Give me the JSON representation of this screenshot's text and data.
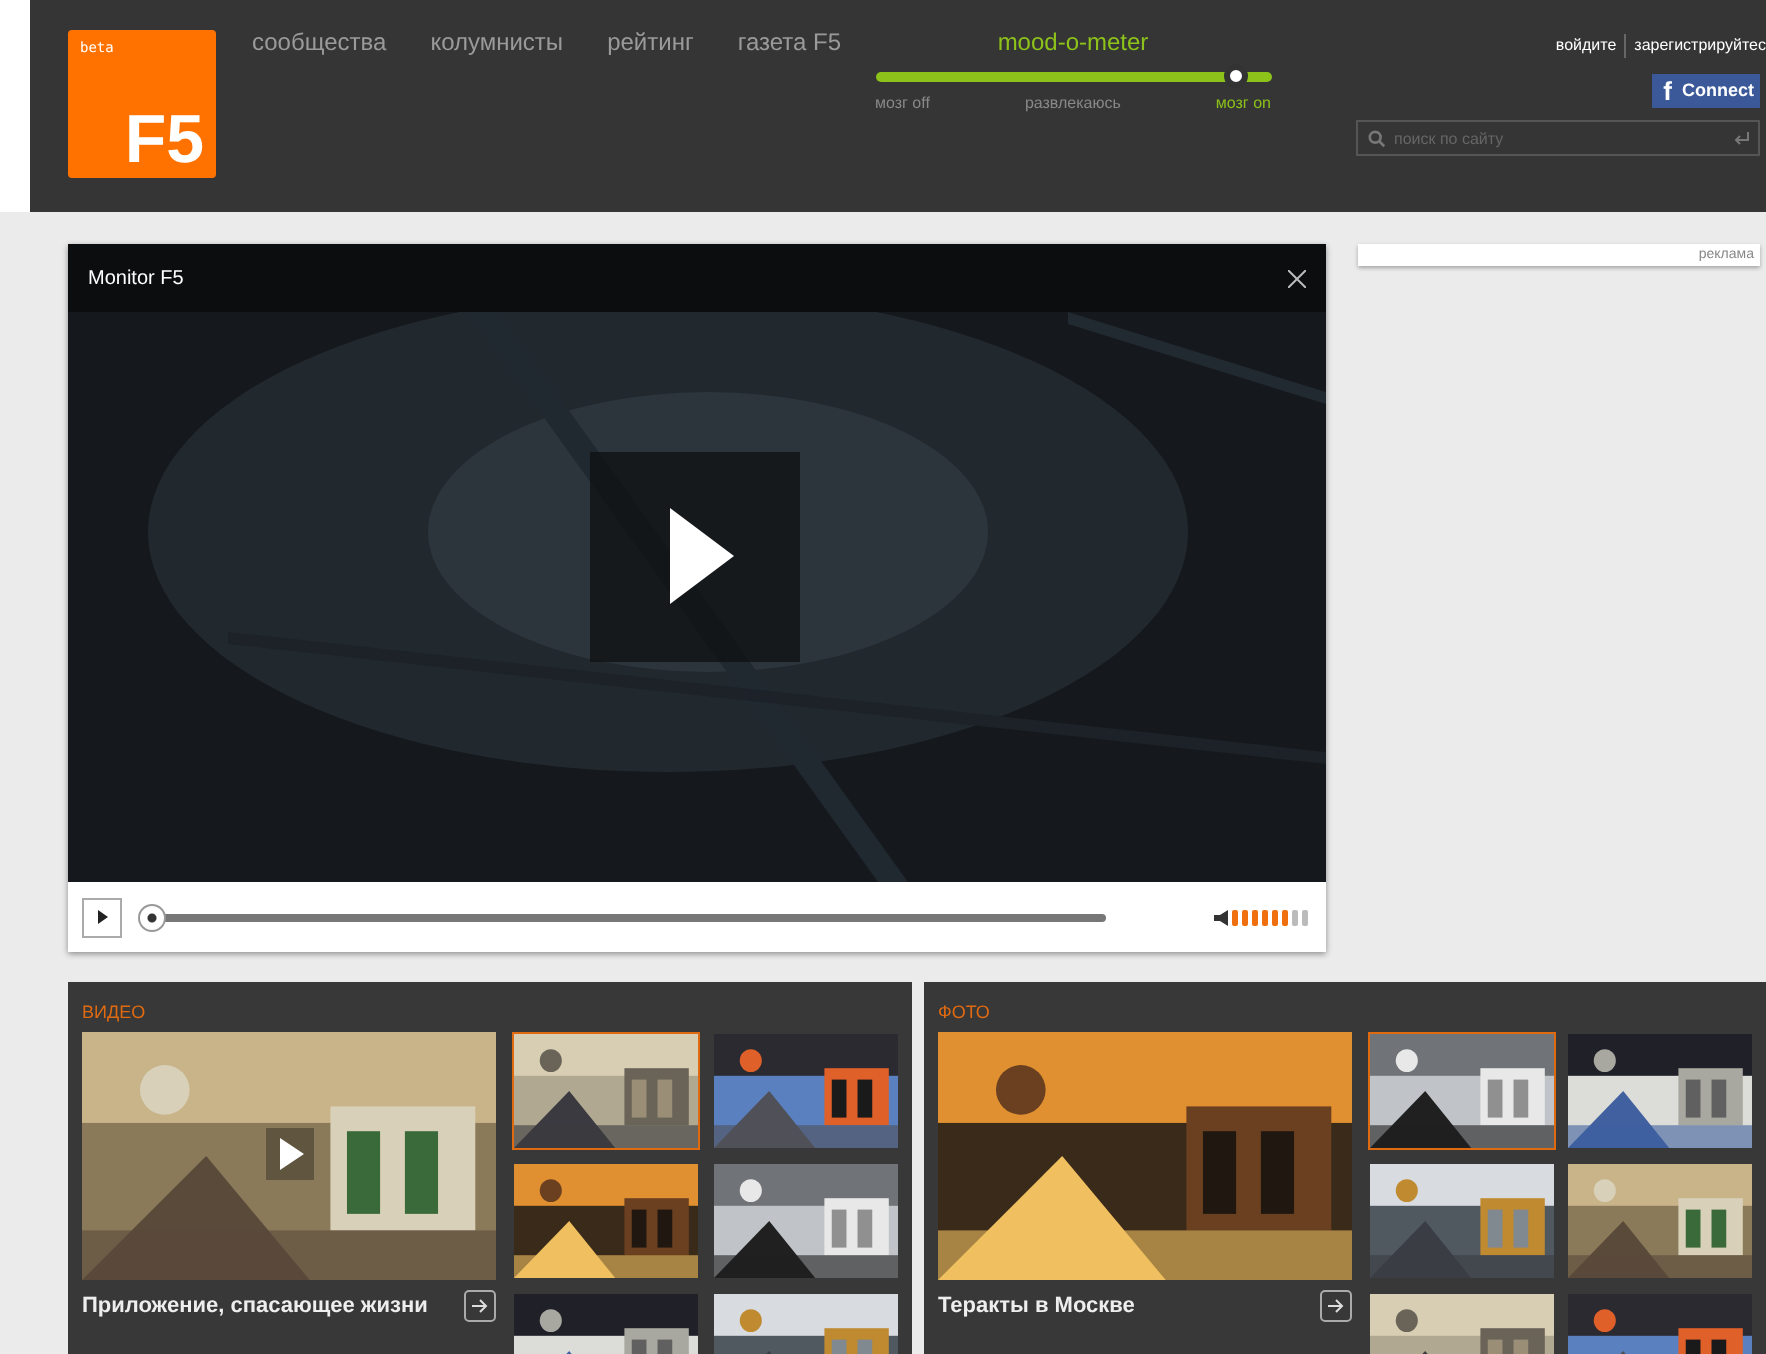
{
  "logo": {
    "badge": "beta",
    "text": "F5"
  },
  "nav": [
    "сообщества",
    "колумнисты",
    "рейтинг",
    "газета F5"
  ],
  "mood_meter": {
    "title": "mood-o-meter",
    "level": 0.91,
    "stops": [
      {
        "label": "мозг off",
        "selected": false
      },
      {
        "label": "развлекаюсь",
        "selected": false
      },
      {
        "label": "мозг on",
        "selected": true
      }
    ]
  },
  "account": {
    "login": "войдите",
    "register": "зарегистрируйтес",
    "facebook_icon": "f",
    "facebook_button": "Connect"
  },
  "search": {
    "placeholder": "поиск по сайту"
  },
  "player": {
    "title": "Monitor F5",
    "progress": {
      "level": 0
    },
    "volume": {
      "level": 0.75
    }
  },
  "ad": {
    "label": "реклама"
  },
  "sections": [
    {
      "title": "ВИДЕО",
      "caption": "Приложение, спасающее жизни",
      "play_overlay": true,
      "thumbnails": [
        {
          "selected": true
        },
        {
          "selected": false
        },
        {
          "selected": false
        },
        {
          "selected": false
        },
        {
          "selected": false
        },
        {
          "selected": false
        }
      ]
    },
    {
      "title": "ФОТО",
      "caption": "Теракты в Москве",
      "play_overlay": false,
      "thumbnails": [
        {
          "selected": true
        },
        {
          "selected": false
        },
        {
          "selected": false
        },
        {
          "selected": false
        },
        {
          "selected": false
        },
        {
          "selected": false
        }
      ]
    }
  ]
}
